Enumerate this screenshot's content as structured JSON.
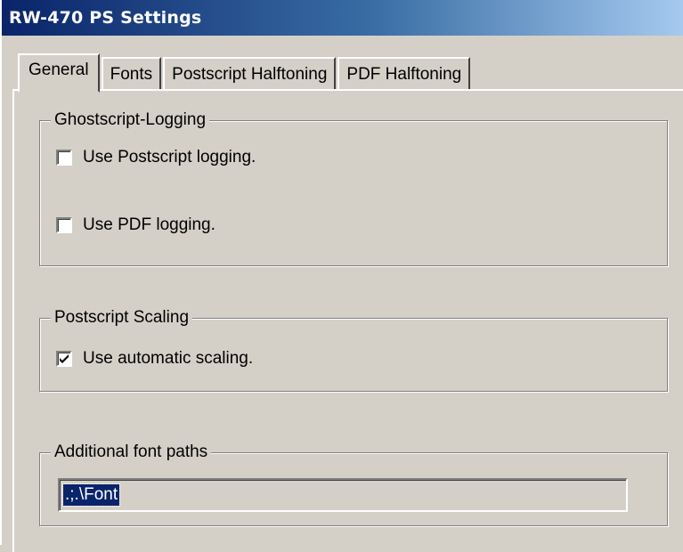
{
  "window": {
    "title": "RW-470 PS Settings"
  },
  "tabs": [
    {
      "label": "General",
      "active": true
    },
    {
      "label": "Fonts",
      "active": false
    },
    {
      "label": "Postscript Halftoning",
      "active": false
    },
    {
      "label": "PDF Halftoning",
      "active": false
    }
  ],
  "groups": {
    "logging": {
      "label": "Ghostscript-Logging",
      "ps_logging": {
        "label": "Use Postscript logging.",
        "checked": false
      },
      "pdf_logging": {
        "label": "Use PDF logging.",
        "checked": false
      }
    },
    "scaling": {
      "label": "Postscript Scaling",
      "auto_scaling": {
        "label": "Use automatic scaling.",
        "checked": true
      }
    },
    "fonts": {
      "label": "Additional font paths",
      "paths_value": ".;.\\Font"
    }
  },
  "colors": {
    "face": "#d4d0c8",
    "title_start": "#0a246a",
    "title_end": "#a6caf0",
    "selection": "#0a246a"
  }
}
